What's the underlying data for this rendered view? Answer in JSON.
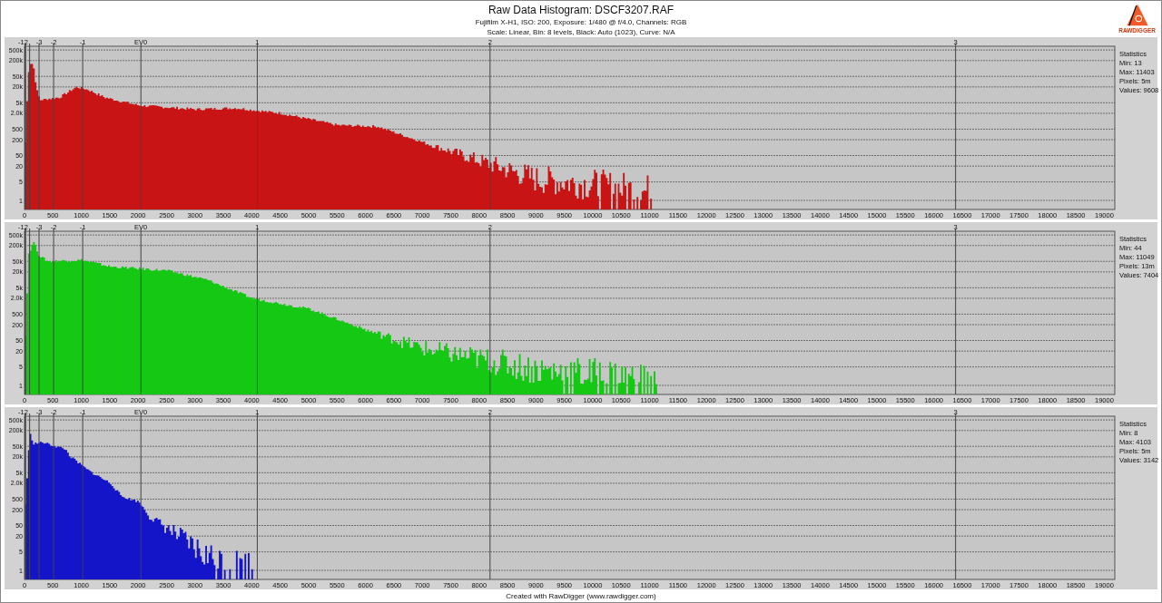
{
  "header": {
    "title": "Raw Data Histogram: DSCF3207.RAF",
    "subtitle": "Fujifilm X-H1, ISO: 200, Exposure: 1/480 @ f/4.0, Channels: RGB",
    "settings": "Scale: Linear, Bin: 8 levels, Black: Auto (1023), Curve: N/A",
    "logo_text": "RAWDIGGER"
  },
  "panels": [
    {
      "color": "#c81414",
      "stats": [
        "Statistics",
        "Min: 13",
        "Max: 11403",
        "Pixels: 5m",
        "Values: 9608"
      ],
      "ev_labels": [
        "-12",
        "-3",
        "-2",
        "-1",
        "EV0",
        "1",
        "2",
        "3"
      ],
      "y_labels": [
        "500k",
        "200k",
        "50k",
        "20k",
        "5k",
        "2.0k",
        "500",
        "200",
        "50",
        "20",
        "5",
        "1"
      ],
      "x_labels": [
        "0",
        "500",
        "1000",
        "1500",
        "2000",
        "2500",
        "3000",
        "3500",
        "4000",
        "4500",
        "5000",
        "5500",
        "6000",
        "6500",
        "7000",
        "7500",
        "8000",
        "8500",
        "9000",
        "9500",
        "10000",
        "10500",
        "11000",
        "11500",
        "12000",
        "12500",
        "13000",
        "13500",
        "14000",
        "14500",
        "15000",
        "15500",
        "16000",
        "16500",
        "17000",
        "17500",
        "18000",
        "18500",
        "19000"
      ]
    },
    {
      "color": "#14c814",
      "stats": [
        "Statistics",
        "Min: 44",
        "Max: 11049",
        "Pixels: 13m",
        "Values: 7404"
      ],
      "ev_labels": [
        "-12",
        "-3",
        "-2",
        "-1",
        "EV0",
        "1",
        "2",
        "3"
      ],
      "y_labels": [
        "500k",
        "200k",
        "50k",
        "20k",
        "5k",
        "2.0k",
        "500",
        "200",
        "50",
        "20",
        "5",
        "1"
      ],
      "x_labels": [
        "0",
        "500",
        "1000",
        "1500",
        "2000",
        "2500",
        "3000",
        "3500",
        "4000",
        "4500",
        "5000",
        "5500",
        "6000",
        "6500",
        "7000",
        "7500",
        "8000",
        "8500",
        "9000",
        "9500",
        "10000",
        "10500",
        "11000",
        "11500",
        "12000",
        "12500",
        "13000",
        "13500",
        "14000",
        "14500",
        "15000",
        "15500",
        "16000",
        "16500",
        "17000",
        "17500",
        "18000",
        "18500",
        "19000"
      ]
    },
    {
      "color": "#1414c8",
      "stats": [
        "Statistics",
        "Min: 8",
        "Max: 4103",
        "Pixels: 5m",
        "Values: 3142"
      ],
      "ev_labels": [
        "-12",
        "-3",
        "-2",
        "-1",
        "EV0",
        "1",
        "2",
        "3"
      ],
      "y_labels": [
        "500k",
        "200k",
        "50k",
        "20k",
        "5k",
        "2.0k",
        "500",
        "200",
        "50",
        "20",
        "5",
        "1"
      ],
      "x_labels": [
        "0",
        "500",
        "1000",
        "1500",
        "2000",
        "2500",
        "3000",
        "3500",
        "4000",
        "4500",
        "5000",
        "5500",
        "6000",
        "6500",
        "7000",
        "7500",
        "8000",
        "8500",
        "9000",
        "9500",
        "10000",
        "10500",
        "11000",
        "11500",
        "12000",
        "12500",
        "13000",
        "13500",
        "14000",
        "14500",
        "15000",
        "15500",
        "16000",
        "16500",
        "17000",
        "17500",
        "18000",
        "18500",
        "19000"
      ]
    }
  ],
  "footer": "Created with RawDigger (www.rawdigger.com)"
}
